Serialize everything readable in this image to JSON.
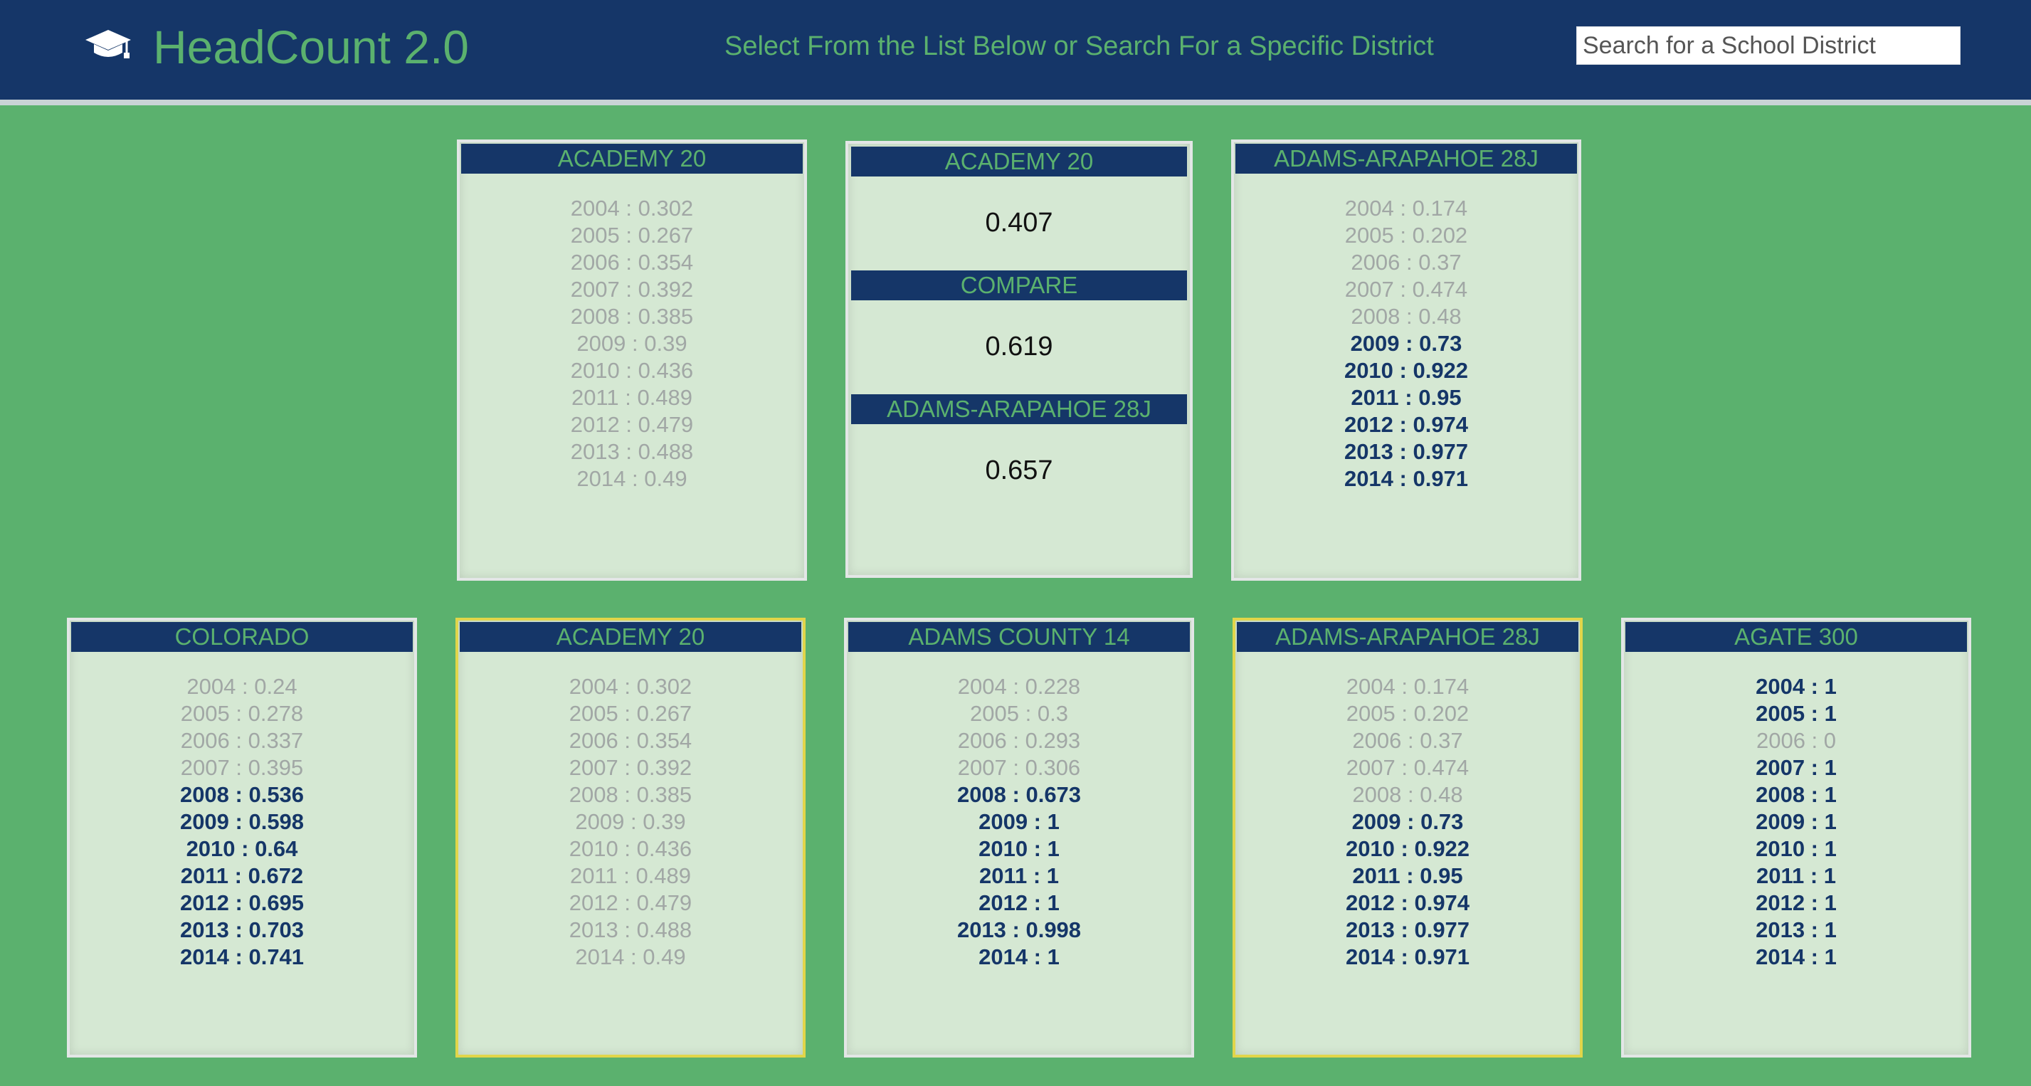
{
  "header": {
    "app_title": "HeadCount 2.0",
    "instruction": "Select From the List Below or Search For a Specific District",
    "search_placeholder": "Search for a School District",
    "logo_icon": "graduation-cap-icon"
  },
  "compare_panel": {
    "left_district": "ACADEMY 20",
    "left_value": "0.407",
    "compare_label": "COMPARE",
    "compare_value": "0.619",
    "right_district": "ADAMS-ARAPAHOE 28J",
    "right_value": "0.657"
  },
  "comparison_cards": [
    {
      "name": "ACADEMY 20",
      "rows": [
        {
          "text": "2004 : 0.302",
          "level": "low"
        },
        {
          "text": "2005 : 0.267",
          "level": "low"
        },
        {
          "text": "2006 : 0.354",
          "level": "low"
        },
        {
          "text": "2007 : 0.392",
          "level": "low"
        },
        {
          "text": "2008 : 0.385",
          "level": "low"
        },
        {
          "text": "2009 : 0.39",
          "level": "low"
        },
        {
          "text": "2010 : 0.436",
          "level": "low"
        },
        {
          "text": "2011 : 0.489",
          "level": "low"
        },
        {
          "text": "2012 : 0.479",
          "level": "low"
        },
        {
          "text": "2013 : 0.488",
          "level": "low"
        },
        {
          "text": "2014 : 0.49",
          "level": "low"
        }
      ]
    },
    {
      "name": "ADAMS-ARAPAHOE 28J",
      "rows": [
        {
          "text": "2004 : 0.174",
          "level": "low"
        },
        {
          "text": "2005 : 0.202",
          "level": "low"
        },
        {
          "text": "2006 : 0.37",
          "level": "low"
        },
        {
          "text": "2007 : 0.474",
          "level": "low"
        },
        {
          "text": "2008 : 0.48",
          "level": "low"
        },
        {
          "text": "2009 : 0.73",
          "level": "high"
        },
        {
          "text": "2010 : 0.922",
          "level": "high"
        },
        {
          "text": "2011 : 0.95",
          "level": "high"
        },
        {
          "text": "2012 : 0.974",
          "level": "high"
        },
        {
          "text": "2013 : 0.977",
          "level": "high"
        },
        {
          "text": "2014 : 0.971",
          "level": "high"
        }
      ]
    }
  ],
  "district_cards": [
    {
      "name": "COLORADO",
      "selected": false,
      "rows": [
        {
          "text": "2004 : 0.24",
          "level": "low"
        },
        {
          "text": "2005 : 0.278",
          "level": "low"
        },
        {
          "text": "2006 : 0.337",
          "level": "low"
        },
        {
          "text": "2007 : 0.395",
          "level": "low"
        },
        {
          "text": "2008 : 0.536",
          "level": "high"
        },
        {
          "text": "2009 : 0.598",
          "level": "high"
        },
        {
          "text": "2010 : 0.64",
          "level": "high"
        },
        {
          "text": "2011 : 0.672",
          "level": "high"
        },
        {
          "text": "2012 : 0.695",
          "level": "high"
        },
        {
          "text": "2013 : 0.703",
          "level": "high"
        },
        {
          "text": "2014 : 0.741",
          "level": "high"
        }
      ]
    },
    {
      "name": "ACADEMY 20",
      "selected": true,
      "rows": [
        {
          "text": "2004 : 0.302",
          "level": "low"
        },
        {
          "text": "2005 : 0.267",
          "level": "low"
        },
        {
          "text": "2006 : 0.354",
          "level": "low"
        },
        {
          "text": "2007 : 0.392",
          "level": "low"
        },
        {
          "text": "2008 : 0.385",
          "level": "low"
        },
        {
          "text": "2009 : 0.39",
          "level": "low"
        },
        {
          "text": "2010 : 0.436",
          "level": "low"
        },
        {
          "text": "2011 : 0.489",
          "level": "low"
        },
        {
          "text": "2012 : 0.479",
          "level": "low"
        },
        {
          "text": "2013 : 0.488",
          "level": "low"
        },
        {
          "text": "2014 : 0.49",
          "level": "low"
        }
      ]
    },
    {
      "name": "ADAMS COUNTY 14",
      "selected": false,
      "rows": [
        {
          "text": "2004 : 0.228",
          "level": "low"
        },
        {
          "text": "2005 : 0.3",
          "level": "low"
        },
        {
          "text": "2006 : 0.293",
          "level": "low"
        },
        {
          "text": "2007 : 0.306",
          "level": "low"
        },
        {
          "text": "2008 : 0.673",
          "level": "high"
        },
        {
          "text": "2009 : 1",
          "level": "high"
        },
        {
          "text": "2010 : 1",
          "level": "high"
        },
        {
          "text": "2011 : 1",
          "level": "high"
        },
        {
          "text": "2012 : 1",
          "level": "high"
        },
        {
          "text": "2013 : 0.998",
          "level": "high"
        },
        {
          "text": "2014 : 1",
          "level": "high"
        }
      ]
    },
    {
      "name": "ADAMS-ARAPAHOE 28J",
      "selected": true,
      "rows": [
        {
          "text": "2004 : 0.174",
          "level": "low"
        },
        {
          "text": "2005 : 0.202",
          "level": "low"
        },
        {
          "text": "2006 : 0.37",
          "level": "low"
        },
        {
          "text": "2007 : 0.474",
          "level": "low"
        },
        {
          "text": "2008 : 0.48",
          "level": "low"
        },
        {
          "text": "2009 : 0.73",
          "level": "high"
        },
        {
          "text": "2010 : 0.922",
          "level": "high"
        },
        {
          "text": "2011 : 0.95",
          "level": "high"
        },
        {
          "text": "2012 : 0.974",
          "level": "high"
        },
        {
          "text": "2013 : 0.977",
          "level": "high"
        },
        {
          "text": "2014 : 0.971",
          "level": "high"
        }
      ]
    },
    {
      "name": "AGATE 300",
      "selected": false,
      "rows": [
        {
          "text": "2004 : 1",
          "level": "high"
        },
        {
          "text": "2005 : 1",
          "level": "high"
        },
        {
          "text": "2006 : 0",
          "level": "low"
        },
        {
          "text": "2007 : 1",
          "level": "high"
        },
        {
          "text": "2008 : 1",
          "level": "high"
        },
        {
          "text": "2009 : 1",
          "level": "high"
        },
        {
          "text": "2010 : 1",
          "level": "high"
        },
        {
          "text": "2011 : 1",
          "level": "high"
        },
        {
          "text": "2012 : 1",
          "level": "high"
        },
        {
          "text": "2013 : 1",
          "level": "high"
        },
        {
          "text": "2014 : 1",
          "level": "high"
        }
      ]
    }
  ],
  "colors": {
    "background": "#5bb16e",
    "header": "#153668",
    "card": "#d5e8d3",
    "selected_border": "#e1d54a",
    "low_value_text": "#a1a7a5",
    "high_value_text": "#153668"
  }
}
